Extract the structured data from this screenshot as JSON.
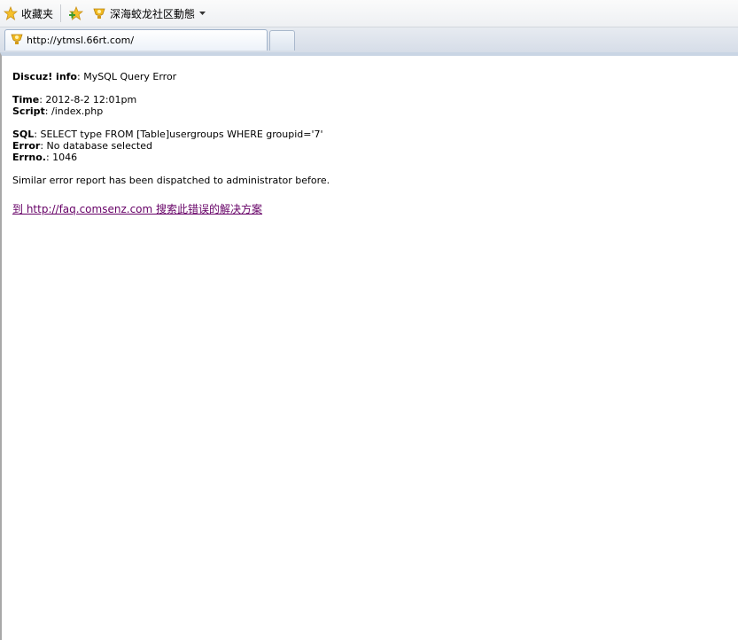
{
  "favorites_bar": {
    "favorites_label": "收藏夹",
    "site_link_label": "深海蛟龙社区動態"
  },
  "tab": {
    "url": "http://ytmsl.66rt.com/"
  },
  "error_page": {
    "info_label": "Discuz! info",
    "info_value": ": MySQL Query Error",
    "time_label": "Time",
    "time_value": ": 2012-8-2 12:01pm",
    "script_label": "Script",
    "script_value": ": /index.php",
    "sql_label": "SQL",
    "sql_value": ": SELECT type FROM [Table]usergroups WHERE groupid='7'",
    "error_label": "Error",
    "error_value": ": No database selected",
    "errno_label": "Errno.",
    "errno_value": ": 1046",
    "report_text": "Similar error report has been dispatched to administrator before.",
    "faq_link": "到  http://faq.comsenz.com 搜索此错误的解决方案"
  },
  "colors": {
    "link": "#660066",
    "frame_top": "#c9d5e4"
  },
  "icons": [
    "star-icon",
    "add-favorite-icon",
    "site-favicon-icon",
    "dropdown-arrow-icon",
    "tab-favicon-icon"
  ]
}
